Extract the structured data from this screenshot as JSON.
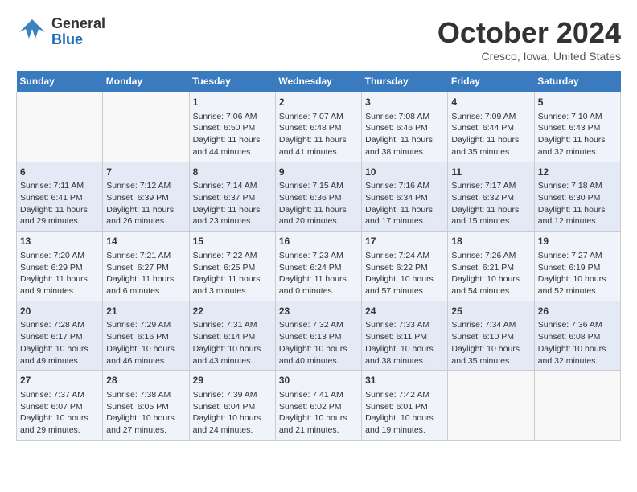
{
  "header": {
    "logo": {
      "general": "General",
      "blue": "Blue",
      "tagline": ""
    },
    "title": "October 2024",
    "subtitle": "Cresco, Iowa, United States"
  },
  "calendar": {
    "days_of_week": [
      "Sunday",
      "Monday",
      "Tuesday",
      "Wednesday",
      "Thursday",
      "Friday",
      "Saturday"
    ],
    "weeks": [
      {
        "days": [
          {
            "num": "",
            "info": ""
          },
          {
            "num": "",
            "info": ""
          },
          {
            "num": "1",
            "info": "Sunrise: 7:06 AM\nSunset: 6:50 PM\nDaylight: 11 hours and 44 minutes."
          },
          {
            "num": "2",
            "info": "Sunrise: 7:07 AM\nSunset: 6:48 PM\nDaylight: 11 hours and 41 minutes."
          },
          {
            "num": "3",
            "info": "Sunrise: 7:08 AM\nSunset: 6:46 PM\nDaylight: 11 hours and 38 minutes."
          },
          {
            "num": "4",
            "info": "Sunrise: 7:09 AM\nSunset: 6:44 PM\nDaylight: 11 hours and 35 minutes."
          },
          {
            "num": "5",
            "info": "Sunrise: 7:10 AM\nSunset: 6:43 PM\nDaylight: 11 hours and 32 minutes."
          }
        ]
      },
      {
        "days": [
          {
            "num": "6",
            "info": "Sunrise: 7:11 AM\nSunset: 6:41 PM\nDaylight: 11 hours and 29 minutes."
          },
          {
            "num": "7",
            "info": "Sunrise: 7:12 AM\nSunset: 6:39 PM\nDaylight: 11 hours and 26 minutes."
          },
          {
            "num": "8",
            "info": "Sunrise: 7:14 AM\nSunset: 6:37 PM\nDaylight: 11 hours and 23 minutes."
          },
          {
            "num": "9",
            "info": "Sunrise: 7:15 AM\nSunset: 6:36 PM\nDaylight: 11 hours and 20 minutes."
          },
          {
            "num": "10",
            "info": "Sunrise: 7:16 AM\nSunset: 6:34 PM\nDaylight: 11 hours and 17 minutes."
          },
          {
            "num": "11",
            "info": "Sunrise: 7:17 AM\nSunset: 6:32 PM\nDaylight: 11 hours and 15 minutes."
          },
          {
            "num": "12",
            "info": "Sunrise: 7:18 AM\nSunset: 6:30 PM\nDaylight: 11 hours and 12 minutes."
          }
        ]
      },
      {
        "days": [
          {
            "num": "13",
            "info": "Sunrise: 7:20 AM\nSunset: 6:29 PM\nDaylight: 11 hours and 9 minutes."
          },
          {
            "num": "14",
            "info": "Sunrise: 7:21 AM\nSunset: 6:27 PM\nDaylight: 11 hours and 6 minutes."
          },
          {
            "num": "15",
            "info": "Sunrise: 7:22 AM\nSunset: 6:25 PM\nDaylight: 11 hours and 3 minutes."
          },
          {
            "num": "16",
            "info": "Sunrise: 7:23 AM\nSunset: 6:24 PM\nDaylight: 11 hours and 0 minutes."
          },
          {
            "num": "17",
            "info": "Sunrise: 7:24 AM\nSunset: 6:22 PM\nDaylight: 10 hours and 57 minutes."
          },
          {
            "num": "18",
            "info": "Sunrise: 7:26 AM\nSunset: 6:21 PM\nDaylight: 10 hours and 54 minutes."
          },
          {
            "num": "19",
            "info": "Sunrise: 7:27 AM\nSunset: 6:19 PM\nDaylight: 10 hours and 52 minutes."
          }
        ]
      },
      {
        "days": [
          {
            "num": "20",
            "info": "Sunrise: 7:28 AM\nSunset: 6:17 PM\nDaylight: 10 hours and 49 minutes."
          },
          {
            "num": "21",
            "info": "Sunrise: 7:29 AM\nSunset: 6:16 PM\nDaylight: 10 hours and 46 minutes."
          },
          {
            "num": "22",
            "info": "Sunrise: 7:31 AM\nSunset: 6:14 PM\nDaylight: 10 hours and 43 minutes."
          },
          {
            "num": "23",
            "info": "Sunrise: 7:32 AM\nSunset: 6:13 PM\nDaylight: 10 hours and 40 minutes."
          },
          {
            "num": "24",
            "info": "Sunrise: 7:33 AM\nSunset: 6:11 PM\nDaylight: 10 hours and 38 minutes."
          },
          {
            "num": "25",
            "info": "Sunrise: 7:34 AM\nSunset: 6:10 PM\nDaylight: 10 hours and 35 minutes."
          },
          {
            "num": "26",
            "info": "Sunrise: 7:36 AM\nSunset: 6:08 PM\nDaylight: 10 hours and 32 minutes."
          }
        ]
      },
      {
        "days": [
          {
            "num": "27",
            "info": "Sunrise: 7:37 AM\nSunset: 6:07 PM\nDaylight: 10 hours and 29 minutes."
          },
          {
            "num": "28",
            "info": "Sunrise: 7:38 AM\nSunset: 6:05 PM\nDaylight: 10 hours and 27 minutes."
          },
          {
            "num": "29",
            "info": "Sunrise: 7:39 AM\nSunset: 6:04 PM\nDaylight: 10 hours and 24 minutes."
          },
          {
            "num": "30",
            "info": "Sunrise: 7:41 AM\nSunset: 6:02 PM\nDaylight: 10 hours and 21 minutes."
          },
          {
            "num": "31",
            "info": "Sunrise: 7:42 AM\nSunset: 6:01 PM\nDaylight: 10 hours and 19 minutes."
          },
          {
            "num": "",
            "info": ""
          },
          {
            "num": "",
            "info": ""
          }
        ]
      }
    ]
  }
}
